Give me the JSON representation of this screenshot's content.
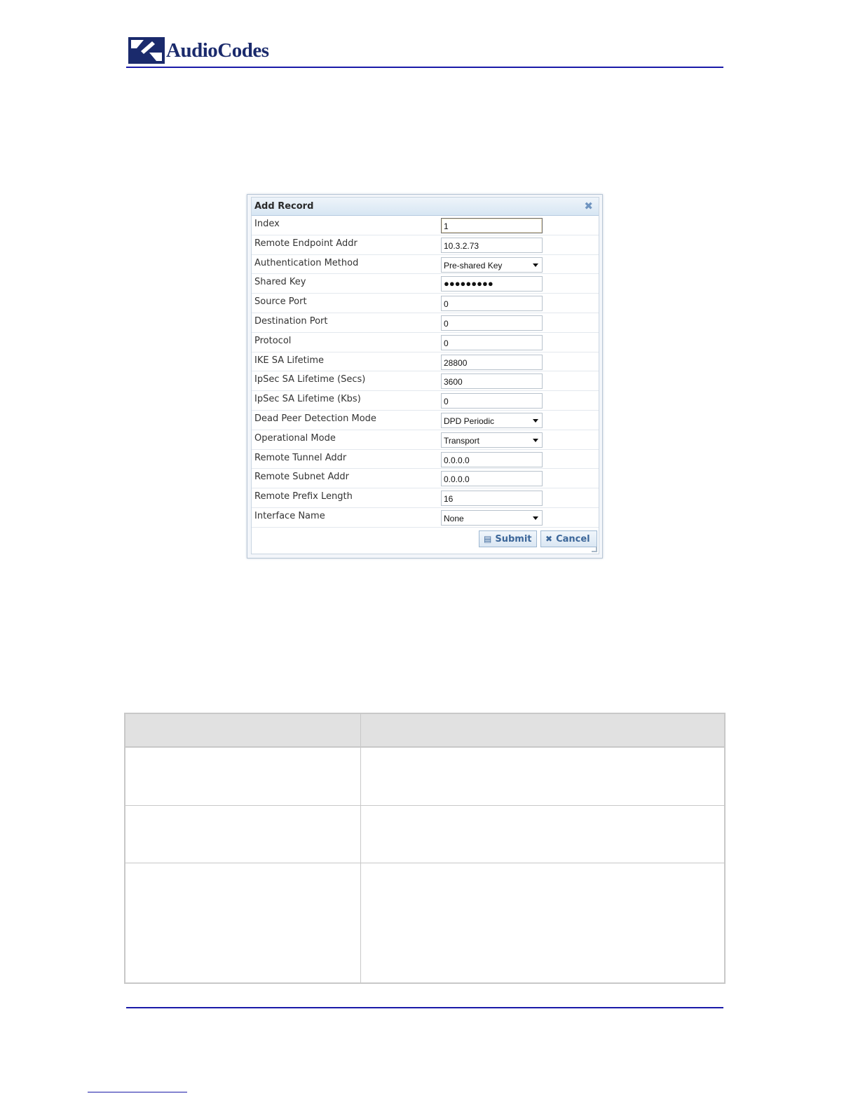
{
  "header": {
    "logo_text": "AudioCodes"
  },
  "dialog": {
    "title": "Add Record",
    "fields": [
      {
        "label": "Index",
        "value": "1",
        "type": "text"
      },
      {
        "label": "Remote Endpoint Addr",
        "value": "10.3.2.73",
        "type": "text"
      },
      {
        "label": "Authentication Method",
        "value": "Pre-shared Key",
        "type": "select"
      },
      {
        "label": "Shared Key",
        "value": "●●●●●●●●●",
        "type": "password"
      },
      {
        "label": "Source Port",
        "value": "0",
        "type": "text"
      },
      {
        "label": "Destination Port",
        "value": "0",
        "type": "text"
      },
      {
        "label": "Protocol",
        "value": "0",
        "type": "text"
      },
      {
        "label": "IKE SA Lifetime",
        "value": "28800",
        "type": "text"
      },
      {
        "label": "IpSec SA Lifetime (Secs)",
        "value": "3600",
        "type": "text"
      },
      {
        "label": "IpSec SA Lifetime (Kbs)",
        "value": "0",
        "type": "text"
      },
      {
        "label": "Dead Peer Detection Mode",
        "value": "DPD Periodic",
        "type": "select"
      },
      {
        "label": "Operational Mode",
        "value": "Transport",
        "type": "select"
      },
      {
        "label": "Remote Tunnel Addr",
        "value": "0.0.0.0",
        "type": "text"
      },
      {
        "label": "Remote Subnet Addr",
        "value": "0.0.0.0",
        "type": "text"
      },
      {
        "label": "Remote Prefix Length",
        "value": "16",
        "type": "text"
      },
      {
        "label": "Interface Name",
        "value": "None",
        "type": "select"
      }
    ],
    "submit_label": "Submit",
    "cancel_label": "Cancel"
  },
  "colors": {
    "brand_blue": "#1a2a6c",
    "rule_blue": "#1a1aa8",
    "button_text": "#3b6699"
  }
}
